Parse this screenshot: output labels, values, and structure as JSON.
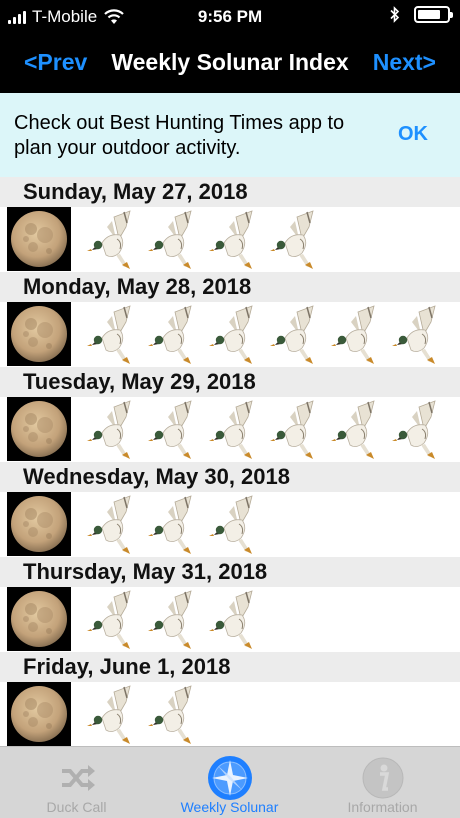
{
  "status": {
    "carrier": "T-Mobile",
    "time": "9:56 PM"
  },
  "nav": {
    "prev": "<Prev",
    "title": "Weekly Solunar Index",
    "next": "Next>"
  },
  "banner": {
    "text": "Check out Best Hunting Times app to plan your outdoor activity.",
    "ok": "OK"
  },
  "days": [
    {
      "date": "Sunday, May 27, 2018",
      "ducks": 4
    },
    {
      "date": "Monday, May 28, 2018",
      "ducks": 6
    },
    {
      "date": "Tuesday, May 29, 2018",
      "ducks": 6
    },
    {
      "date": "Wednesday, May 30, 2018",
      "ducks": 3
    },
    {
      "date": "Thursday, May 31, 2018",
      "ducks": 3
    },
    {
      "date": "Friday, June 1, 2018",
      "ducks": 2
    }
  ],
  "tabs": [
    {
      "label": "Duck Call",
      "icon": "shuffle-icon",
      "active": false
    },
    {
      "label": "Weekly Solunar",
      "icon": "compass-icon",
      "active": true
    },
    {
      "label": "Information",
      "icon": "info-icon",
      "active": false
    }
  ],
  "colors": {
    "accent": "#1e90ff",
    "banner_bg": "#dcf6f9",
    "header_bg": "#ececec",
    "tabbar_bg": "#d6d6d6"
  }
}
